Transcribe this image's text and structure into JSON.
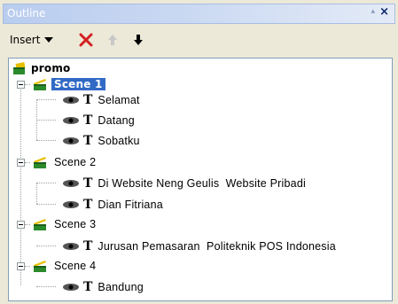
{
  "panel": {
    "title": "Outline",
    "pin_glyph": "▴",
    "close_glyph": "×"
  },
  "toolbar": {
    "insert_label": "Insert",
    "icons": [
      "dropdown-arrow-icon",
      "delete-x-icon",
      "move-up-arrow-icon",
      "move-down-arrow-icon"
    ],
    "delete_color": "#d42020",
    "up_disabled_color": "#c8c8c8"
  },
  "tree": {
    "root": {
      "label": "promo"
    },
    "scenes": [
      {
        "label": "Scene 1",
        "selected": true,
        "items": [
          "Selamat",
          "Datang",
          "Sobatku"
        ]
      },
      {
        "label": "Scene 2",
        "selected": false,
        "items": [
          "Di Website Neng Geulis  Website Pribadi",
          "Dian Fitriana"
        ]
      },
      {
        "label": "Scene 3",
        "selected": false,
        "items": [
          "Jurusan Pemasaran  Politeknik POS Indonesia"
        ]
      },
      {
        "label": "Scene 4",
        "selected": false,
        "items": [
          "Bandung"
        ]
      }
    ],
    "text_glyph": "T",
    "selection_color": "#316ac5"
  }
}
